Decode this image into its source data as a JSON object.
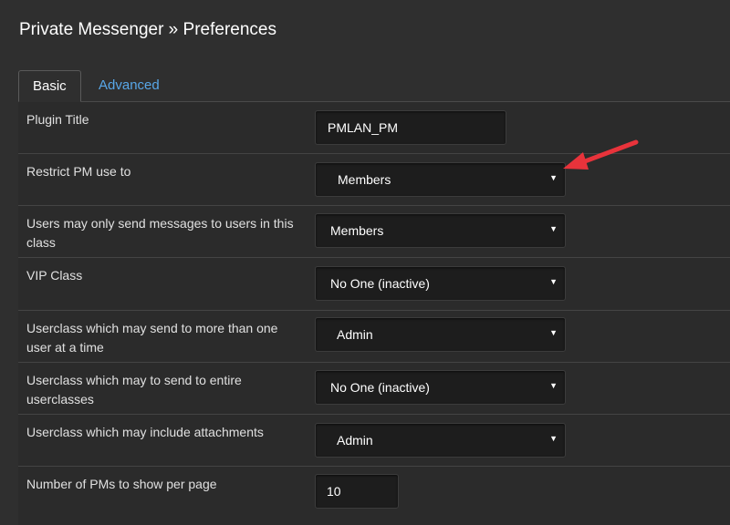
{
  "page": {
    "title": "Private Messenger » Preferences"
  },
  "tabs": [
    {
      "label": "Basic",
      "active": true
    },
    {
      "label": "Advanced",
      "active": false
    }
  ],
  "fields": [
    {
      "label": "Plugin Title",
      "type": "text",
      "value": "PMLAN_PM"
    },
    {
      "label": "Restrict PM use to",
      "type": "select",
      "value": "Members"
    },
    {
      "label": "Users may only send messages to users in this class",
      "type": "select",
      "value": "Members"
    },
    {
      "label": "VIP Class",
      "type": "select",
      "value": "No One (inactive)"
    },
    {
      "label": "Userclass which may send to more than one user at a time",
      "type": "select",
      "value": "Admin"
    },
    {
      "label": "Userclass which may to send to entire userclasses",
      "type": "select",
      "value": "No One (inactive)"
    },
    {
      "label": "Userclass which may include attachments",
      "type": "select",
      "value": "Admin"
    },
    {
      "label": "Number of PMs to show per page",
      "type": "text",
      "value": "10"
    }
  ],
  "icons": {
    "dropdown": "caret-down-icon",
    "annotation": "red-arrow-icon"
  },
  "colors": {
    "background": "#2f2f2f",
    "link": "#58a7e8",
    "annotation_arrow": "#e8333b"
  }
}
